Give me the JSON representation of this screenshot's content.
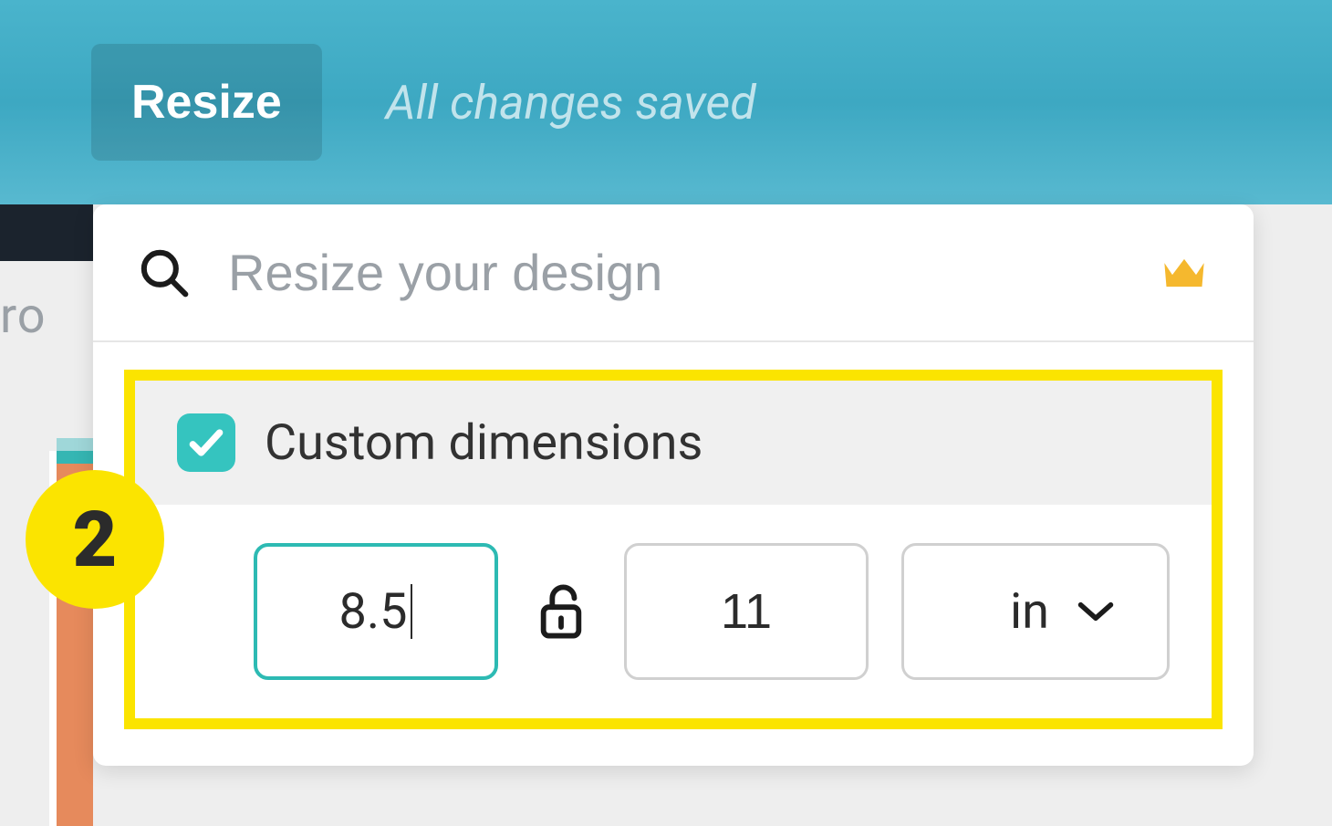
{
  "header": {
    "resize_label": "Resize",
    "save_status": "All changes saved"
  },
  "dropdown": {
    "search_placeholder": "Resize your design",
    "custom_dimensions_label": "Custom dimensions",
    "custom_dimensions_checked": true,
    "width_value": "8.5",
    "height_value": "11",
    "unit_value": "in"
  },
  "annotation": {
    "step_number": "2"
  },
  "left_fragment": "ro",
  "icons": {
    "search": "search-icon",
    "crown": "crown-icon",
    "check": "check-icon",
    "lock_open": "lock-open-icon",
    "chevron_down": "chevron-down-icon"
  },
  "colors": {
    "accent_teal": "#35c4bf",
    "highlight_yellow": "#fbe400",
    "header_blue": "#3da8c2"
  }
}
